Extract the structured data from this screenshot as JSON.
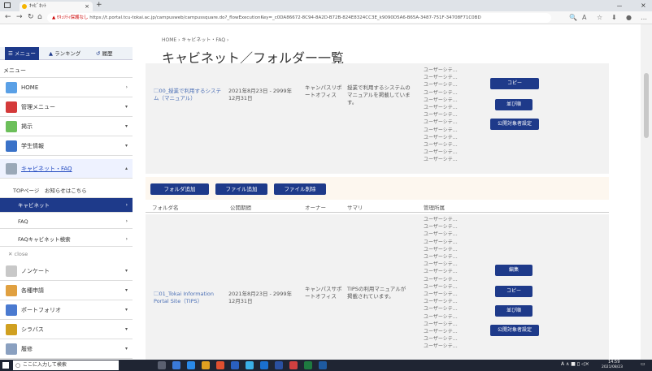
{
  "browser": {
    "tab_title": "ｷｬﾋﾞﾈｯﾄ",
    "tab_close": "×",
    "new_tab": "+",
    "win_minimize": "－",
    "win_close": "×",
    "url_warning": "▲ ｾｷｭﾘﾃｨ保護なし",
    "url": "https://t.portal.tcu-tokai.ac.jp/campusweb/campussquare.do?_flowExecutionKey=_c0DA86672-8C94-8A2D-B72B-824E8324CC3E_k9090D5A6-B65A-3487-751F-34708F71C0BD"
  },
  "sidebar": {
    "tabs": [
      {
        "label": "☰ メニュー"
      },
      {
        "label": "ランキング"
      },
      {
        "label": "履歴"
      }
    ],
    "header": "メニュー",
    "items": [
      {
        "label": "HOME",
        "arrow": "›"
      },
      {
        "label": "管理メニュー",
        "arrow": "▾"
      },
      {
        "label": "掲示",
        "arrow": "▾"
      },
      {
        "label": "学生情報",
        "arrow": "▾"
      },
      {
        "label": "キャビネット・FAQ",
        "arrow": "▴"
      },
      {
        "label": "ノンケート",
        "arrow": "▾"
      },
      {
        "label": "各種申請",
        "arrow": "▾"
      },
      {
        "label": "ポートフォリオ",
        "arrow": "▾"
      },
      {
        "label": "シラバス",
        "arrow": "▾"
      },
      {
        "label": "履修",
        "arrow": "▾"
      }
    ],
    "subitems": [
      {
        "label": "TOPページ　お知らせはこちら"
      },
      {
        "label": "キャビネット",
        "arrow": "›"
      },
      {
        "label": "FAQ",
        "arrow": "›"
      },
      {
        "label": "FAQキャビネット検索",
        "arrow": "›"
      }
    ],
    "close": "✕ close"
  },
  "main": {
    "breadcrumb": "HOME › キャビネット・FAQ ›",
    "title": "キャビネット／フォルダー一覧",
    "row1": {
      "folder": "00_授業で利用するシステム（マニュアル）",
      "period": "2021年8月23日 - 2999年12月31日",
      "owner": "キャンパスリポートオフィス",
      "summary": "授業で利用するシステムのマニュアルを掲載しています。",
      "admins": [
        "ユーザーシテ…",
        "ユーザーシテ…",
        "ユーザーシテ…",
        "ユーザーシテ…",
        "ユーザーシテ…",
        "ユーザーシテ…",
        "ユーザーシテ…",
        "ユーザーシテ…",
        "ユーザーシテ…",
        "ユーザーシテ…",
        "ユーザーシテ…",
        "ユーザーシテ…",
        "ユーザーシテ…"
      ],
      "copy": "コピー",
      "sort": "並び順",
      "publish": "公開対象者設定"
    },
    "toolbar": {
      "add_folder": "フォルダ追加",
      "add_file": "ファイル追加",
      "delete_file": "ファイル削除"
    },
    "headers": {
      "folder": "フォルダ名",
      "period": "公開期間",
      "owner": "オーナー",
      "summary": "サマリ",
      "admin": "管理所属"
    },
    "row2": {
      "folder": "01_Tokai Information Portal Site（TIPS）",
      "period": "2021年8月23日 - 2999年12月31日",
      "owner": "キャンパスサポートオフィス",
      "summary": "TIPSの利用マニュアルが掲載されています。",
      "admins": [
        "ユーザーシテ…",
        "ユーザーシテ…",
        "ユーザーシテ…",
        "ユーザーシテ…",
        "ユーザーシテ…",
        "ユーザーシテ…",
        "ユーザーシテ…",
        "ユーザーシテ…",
        "ユーザーシテ…",
        "ユーザーシテ…",
        "ユーザーシテ…",
        "ユーザーシテ…",
        "ユーザーシテ…",
        "ユーザーシテ…",
        "ユーザーシテ…",
        "ユーザーシテ…",
        "ユーザーシテ…",
        "ユーザーシテ…"
      ],
      "edit": "編集",
      "copy": "コピー",
      "sort": "並び順",
      "publish": "公開対象者設定"
    }
  },
  "taskbar": {
    "search_placeholder": "ここに入力して検索",
    "tray": "A ∧ ■ ▯ ◁×",
    "time": "14:59",
    "date": "2021/08/23"
  }
}
